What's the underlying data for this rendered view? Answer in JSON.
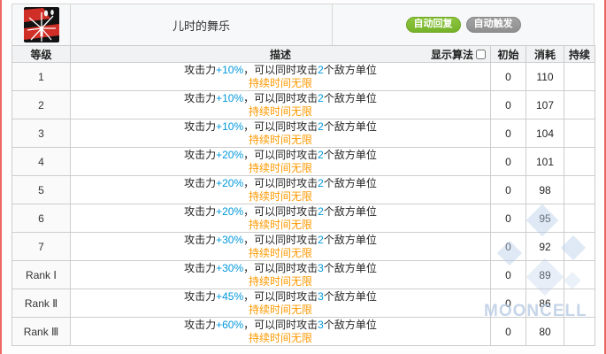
{
  "header": {
    "skill_name": "儿时的舞乐",
    "skill_icon": "dancer-starburst-icon",
    "badges": [
      {
        "label": "自动回复"
      },
      {
        "label": "自动触发"
      }
    ]
  },
  "table": {
    "columns": {
      "level": "等级",
      "description": "描述",
      "show_formula": "显示算法",
      "initial": "初始",
      "cost": "消耗",
      "duration": "持续"
    },
    "desc_parts": {
      "prefix": "攻击力",
      "mid": "，可以同时攻击",
      "suffix": "个敌方单位",
      "line2": "持续时间无限"
    },
    "rows": [
      {
        "level": "1",
        "atk": "+10%",
        "targets": "2",
        "initial": "0",
        "cost": "110",
        "duration": ""
      },
      {
        "level": "2",
        "atk": "+10%",
        "targets": "2",
        "initial": "0",
        "cost": "107",
        "duration": ""
      },
      {
        "level": "3",
        "atk": "+10%",
        "targets": "2",
        "initial": "0",
        "cost": "104",
        "duration": ""
      },
      {
        "level": "4",
        "atk": "+20%",
        "targets": "2",
        "initial": "0",
        "cost": "101",
        "duration": ""
      },
      {
        "level": "5",
        "atk": "+20%",
        "targets": "2",
        "initial": "0",
        "cost": "98",
        "duration": ""
      },
      {
        "level": "6",
        "atk": "+20%",
        "targets": "2",
        "initial": "0",
        "cost": "95",
        "duration": ""
      },
      {
        "level": "7",
        "atk": "+30%",
        "targets": "2",
        "initial": "0",
        "cost": "92",
        "duration": ""
      },
      {
        "level": "Rank Ⅰ",
        "atk": "+30%",
        "targets": "3",
        "initial": "0",
        "cost": "89",
        "duration": ""
      },
      {
        "level": "Rank Ⅱ",
        "atk": "+45%",
        "targets": "3",
        "initial": "0",
        "cost": "86",
        "duration": ""
      },
      {
        "level": "Rank Ⅲ",
        "atk": "+60%",
        "targets": "3",
        "initial": "0",
        "cost": "80",
        "duration": ""
      }
    ]
  },
  "colors": {
    "buff_blue": "#0098dc",
    "duration_orange": "#ff9900",
    "badge_green": "#8cc63e",
    "badge_gray": "#a3a3a3",
    "icon_red": "#cf2f27"
  },
  "watermark": {
    "text": "MOONCELL"
  }
}
